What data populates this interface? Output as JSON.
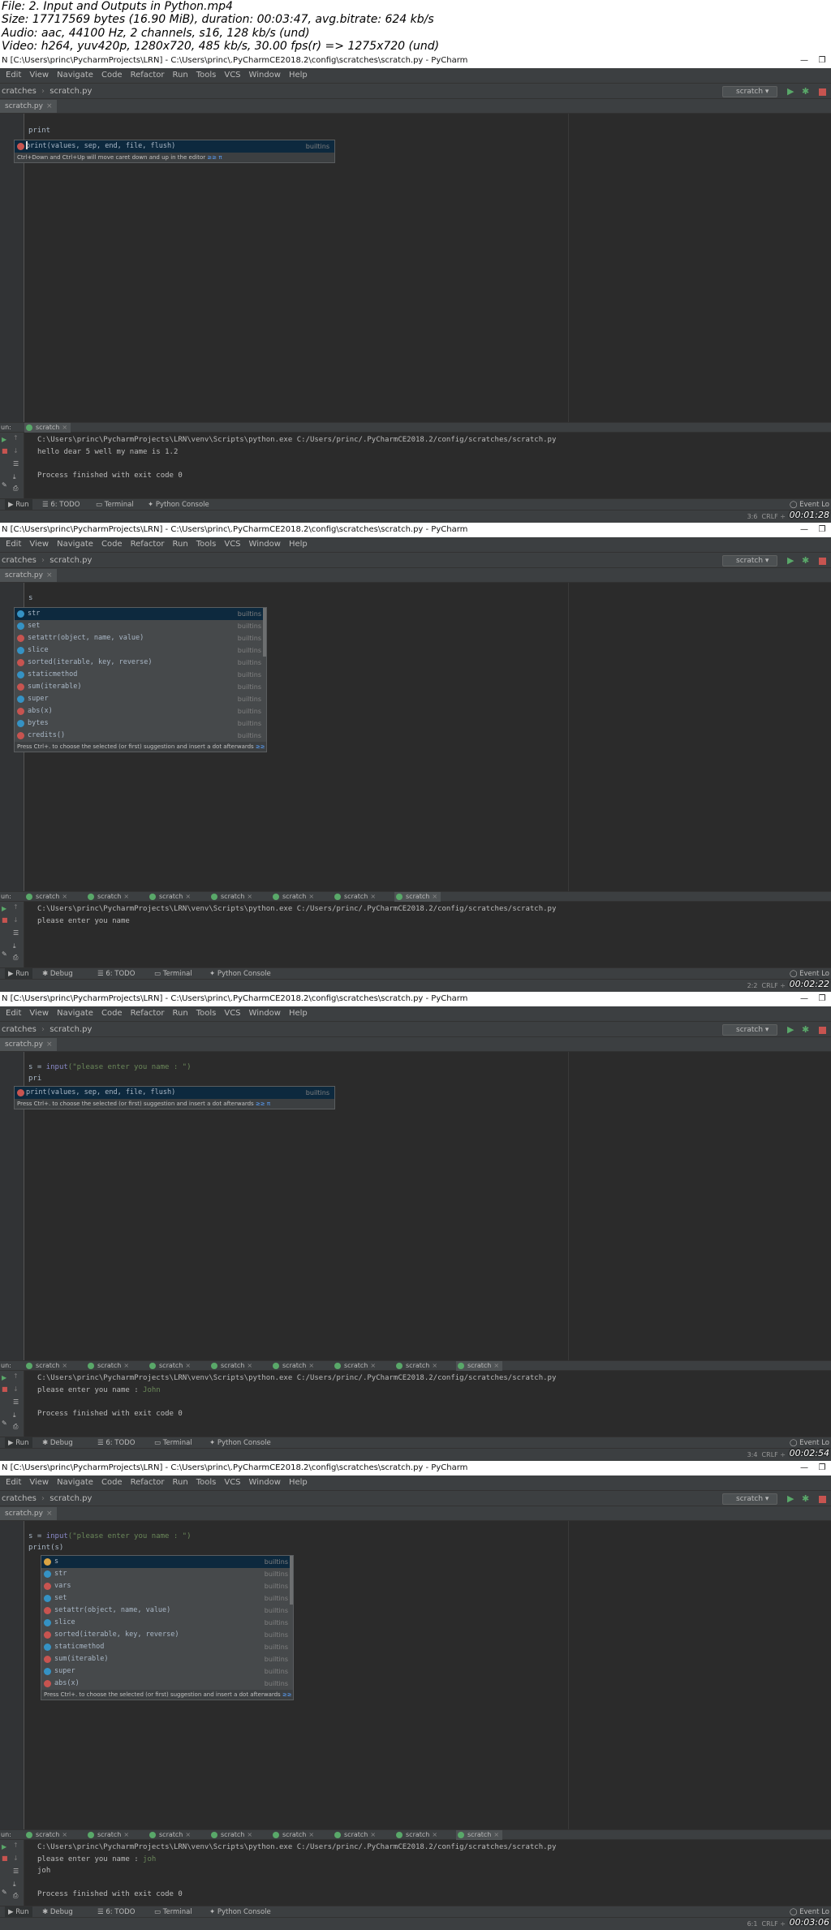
{
  "header": {
    "lines": [
      "File: 2. Input and Outputs in Python.mp4",
      "Size: 17717569 bytes (16.90 MiB), duration: 00:03:47, avg.bitrate: 624 kb/s",
      "Audio: aac, 44100 Hz, 2 channels, s16, 128 kb/s (und)",
      "Video: h264, yuv420p, 1280x720, 485 kb/s, 30.00 fps(r) => 1275x720 (und)"
    ]
  },
  "ide": {
    "window_title": "N [C:\\Users\\princ\\PycharmProjects\\LRN] - C:\\Users\\princ\\.PyCharmCE2018.2\\config\\scratches\\scratch.py - PyCharm",
    "win_min": "—",
    "win_max": "❐",
    "menu": [
      "Edit",
      "View",
      "Navigate",
      "Code",
      "Refactor",
      "Run",
      "Tools",
      "VCS",
      "Window",
      "Help"
    ],
    "nav_crumb": "cratches",
    "nav_file": "scratch.py",
    "run_config": "scratch",
    "editor_tab": "scratch.py",
    "run_label": "un:",
    "run_tab": "scratch",
    "bottom_run": "Run",
    "bottom_debug": "Debug",
    "bottom_todo": "6: TODO",
    "bottom_terminal": "Terminal",
    "bottom_console": "Python Console",
    "event_log": "Event Lo",
    "crlf": "CRLF ÷",
    "console_cmd": "C:\\Users\\princ\\PycharmProjects\\LRN\\venv\\Scripts\\python.exe C:/Users/princ/.PyCharmCE2018.2/config/scratches/scratch.py",
    "builtins": "builtins",
    "hint_link": "≥≥ π"
  },
  "frames": [
    {
      "timestamp": "00:01:28",
      "cursor_pos": "3:6",
      "code_line1": "print",
      "popup_item": "print(values, sep, end, file, flush)",
      "popup_hint": "Ctrl+Down and Ctrl+Up will move caret down and up in the editor",
      "console_out1": "hello dear 5 well my name is 1.2",
      "console_out2": "Process finished with exit code 0"
    },
    {
      "timestamp": "00:02:22",
      "cursor_pos": "2:2",
      "code_line1": "s",
      "popup_items": [
        {
          "name": "str",
          "kind": "c"
        },
        {
          "name": "set",
          "kind": "c"
        },
        {
          "name": "setattr(object, name, value)",
          "kind": "f"
        },
        {
          "name": "slice",
          "kind": "c"
        },
        {
          "name": "sorted(iterable, key, reverse)",
          "kind": "f"
        },
        {
          "name": "staticmethod",
          "kind": "c"
        },
        {
          "name": "sum(iterable)",
          "kind": "f"
        },
        {
          "name": "super",
          "kind": "c"
        },
        {
          "name": "abs(x)",
          "kind": "f"
        },
        {
          "name": "bytes",
          "kind": "c"
        },
        {
          "name": "credits()",
          "kind": "f"
        }
      ],
      "popup_hint": "Press Ctrl+. to choose the selected (or first) suggestion and insert a dot afterwards",
      "console_out1": "please enter you name"
    },
    {
      "timestamp": "00:02:54",
      "cursor_pos": "3:4",
      "code_line1_var": "s = ",
      "code_line1_fn": "input",
      "code_line1_str": "(\"please enter you name : \")",
      "code_line2": "pri",
      "popup_item": "print(values, sep, end, file, flush)",
      "popup_hint": "Press Ctrl+. to choose the selected (or first) suggestion and insert a dot afterwards",
      "console_out1": "please enter you name : ",
      "console_input": "John",
      "console_out2": "Process finished with exit code 0"
    },
    {
      "timestamp": "00:03:06",
      "cursor_pos": "6:1",
      "code_line1_var": "s = ",
      "code_line1_fn": "input",
      "code_line1_str": "(\"please enter you name : \")",
      "code_line2": "print(s)",
      "popup_items": [
        {
          "name": "s",
          "kind": "v"
        },
        {
          "name": "str",
          "kind": "c"
        },
        {
          "name": "vars",
          "kind": "f"
        },
        {
          "name": "set",
          "kind": "c"
        },
        {
          "name": "setattr(object, name, value)",
          "kind": "f"
        },
        {
          "name": "slice",
          "kind": "c"
        },
        {
          "name": "sorted(iterable, key, reverse)",
          "kind": "f"
        },
        {
          "name": "staticmethod",
          "kind": "c"
        },
        {
          "name": "sum(iterable)",
          "kind": "f"
        },
        {
          "name": "super",
          "kind": "c"
        },
        {
          "name": "abs(x)",
          "kind": "f"
        }
      ],
      "popup_hint": "Press Ctrl+. to choose the selected (or first) suggestion and insert a dot afterwards",
      "console_out1": "please enter you name : ",
      "console_input": "joh",
      "console_echo": "joh",
      "console_out2": "Process finished with exit code 0"
    }
  ]
}
